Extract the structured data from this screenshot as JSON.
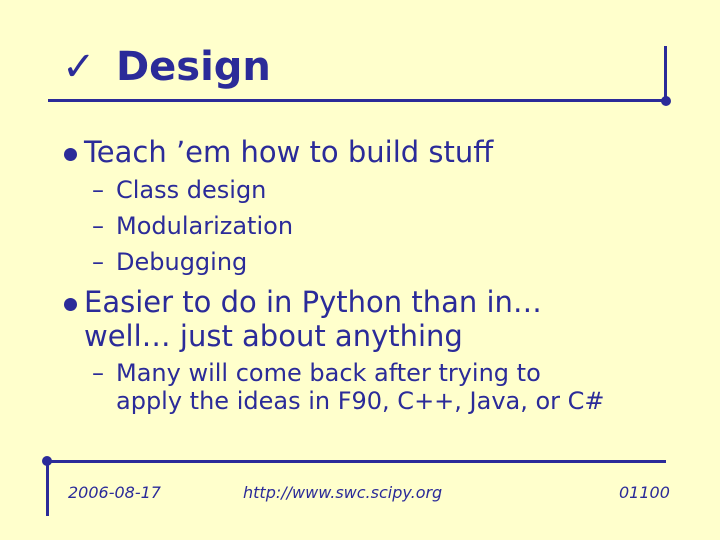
{
  "slide": {
    "title_check": "✓",
    "title": "Design",
    "bullets": [
      {
        "text": "Teach ’em how to build stuff",
        "subs": [
          "Class design",
          "Modularization",
          "Debugging"
        ]
      },
      {
        "line1": "Easier to do in Python than in…",
        "line2": "well… just about anything",
        "sub_line1": "Many will come back after trying to",
        "sub_line2": "apply the ideas in F90, C++, Java, or C#"
      }
    ],
    "dash": "–"
  },
  "footer": {
    "date": "2006-08-17",
    "url": "http://www.swc.scipy.org",
    "page": "01100"
  },
  "colors": {
    "background": "#ffffcc",
    "accent": "#2b2b99"
  }
}
